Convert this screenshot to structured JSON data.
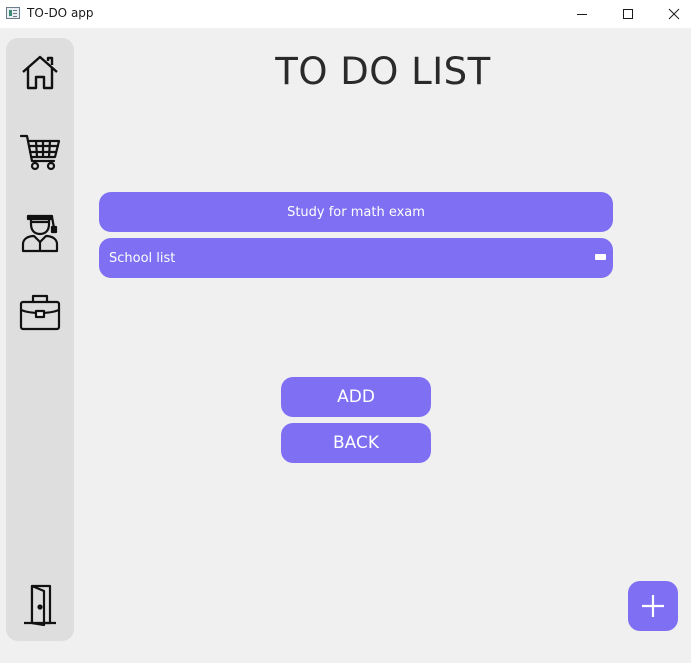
{
  "window": {
    "title": "TO-DO app",
    "icon": "app-icon",
    "controls": [
      "minimize-icon",
      "maximize-icon",
      "close-icon"
    ]
  },
  "sidebar": {
    "items": [
      {
        "icon": "home-icon"
      },
      {
        "icon": "shopping-cart-icon"
      },
      {
        "icon": "graduate-icon"
      },
      {
        "icon": "briefcase-icon"
      }
    ],
    "footer": {
      "icon": "exit-door-icon"
    }
  },
  "main": {
    "title": "TO DO LIST",
    "tasks": [
      {
        "label": "Study for math exam"
      },
      {
        "label": "School list",
        "action_icon": "minus-icon"
      }
    ],
    "buttons": {
      "add_label": "ADD",
      "back_label": "BACK"
    },
    "fab": {
      "icon": "plus-icon"
    }
  },
  "colors": {
    "accent": "#7e6ff3",
    "sidebar_bg": "#dedede",
    "page_bg": "#f0f0f0",
    "text": "#2a2a2a"
  }
}
